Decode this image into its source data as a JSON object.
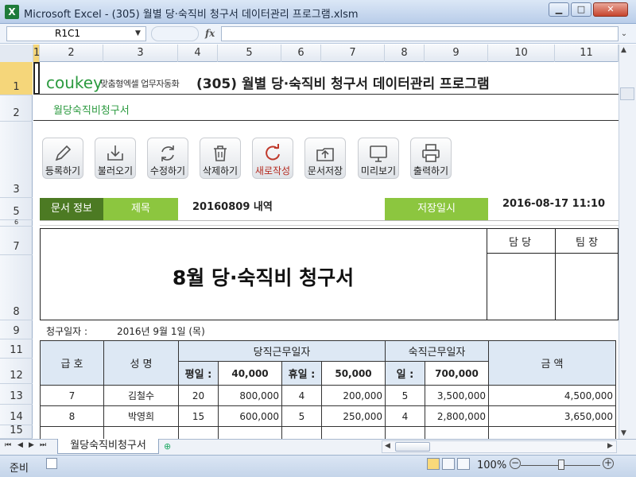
{
  "window": {
    "title": "Microsoft Excel - (305) 월별 당·숙직비 청구서 데이터관리 프로그램.xlsm",
    "app_icon": "X"
  },
  "formula_bar": {
    "name_box": "R1C1",
    "fx": "fx",
    "formula": ""
  },
  "columns": [
    "1",
    "2",
    "3",
    "4",
    "5",
    "6",
    "7",
    "8",
    "9",
    "10",
    "11"
  ],
  "rows": [
    "1",
    "2",
    "3",
    "5",
    "6",
    "7",
    "8",
    "9",
    "11",
    "12",
    "13",
    "14",
    "15"
  ],
  "header": {
    "logo_main": "coukey",
    "logo_sub": "맞춤형엑셀 업무자동화",
    "title": "(305) 월별 당·숙직비 청구서 데이터관리 프로그램",
    "subtitle": "월당숙직비청구서"
  },
  "toolbar": {
    "buttons": [
      {
        "label": "등록하기",
        "icon": "pencil-icon"
      },
      {
        "label": "불러오기",
        "icon": "load-icon"
      },
      {
        "label": "수정하기",
        "icon": "refresh-icon"
      },
      {
        "label": "삭제하기",
        "icon": "trash-icon"
      },
      {
        "label": "새로작성",
        "icon": "new-icon"
      },
      {
        "label": "문서저장",
        "icon": "save-icon"
      },
      {
        "label": "미리보기",
        "icon": "preview-icon"
      },
      {
        "label": "출력하기",
        "icon": "print-icon"
      }
    ]
  },
  "doc_info": {
    "doc_label": "문서 정보",
    "title_label": "제목",
    "title_value": "20160809 내역",
    "saved_label": "저장일시",
    "saved_value": "2016-08-17 11:10"
  },
  "document": {
    "title": "8월 당·숙직비 청구서",
    "approver1": "담 당",
    "approver2": "팀 장",
    "claim_date_label": "청구일자 :",
    "claim_date": "2016년 9월 1일 (목)"
  },
  "table": {
    "h_grade": "급 호",
    "h_name": "성 명",
    "h_duty": "당직근무일자",
    "h_night": "숙직근무일자",
    "h_amount": "금 액",
    "weekday_label": "평일 :",
    "weekday_rate": "40,000",
    "holiday_label": "휴일 :",
    "holiday_rate": "50,000",
    "day_label": "일 :",
    "night_rate": "700,000",
    "rows": [
      {
        "grade": "7",
        "name": "김철수",
        "wd_days": "20",
        "wd_amt": "800,000",
        "hd_days": "4",
        "hd_amt": "200,000",
        "n_days": "5",
        "n_amt": "3,500,000",
        "total": "4,500,000"
      },
      {
        "grade": "8",
        "name": "박영희",
        "wd_days": "15",
        "wd_amt": "600,000",
        "hd_days": "5",
        "hd_amt": "250,000",
        "n_days": "4",
        "n_amt": "2,800,000",
        "total": "3,650,000"
      }
    ]
  },
  "sheet_tabs": [
    "월당숙직비청구서"
  ],
  "status": {
    "mode": "준비",
    "zoom": "100%"
  },
  "colors": {
    "accent_dark": "#4c7a23",
    "accent_light": "#8cc63f",
    "table_header": "#dde8f4"
  }
}
